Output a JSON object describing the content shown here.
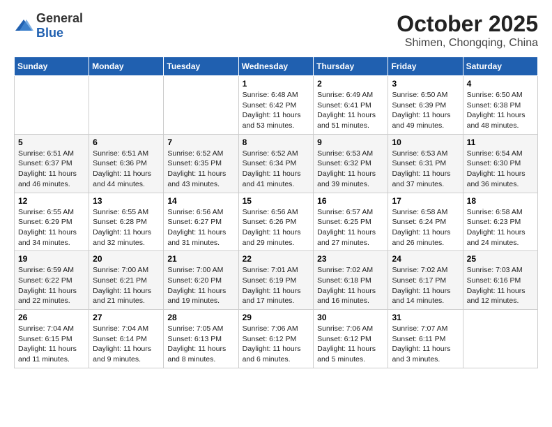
{
  "logo": {
    "general": "General",
    "blue": "Blue"
  },
  "header": {
    "month": "October 2025",
    "location": "Shimen, Chongqing, China"
  },
  "weekdays": [
    "Sunday",
    "Monday",
    "Tuesday",
    "Wednesday",
    "Thursday",
    "Friday",
    "Saturday"
  ],
  "weeks": [
    [
      {
        "day": "",
        "info": ""
      },
      {
        "day": "",
        "info": ""
      },
      {
        "day": "",
        "info": ""
      },
      {
        "day": "1",
        "info": "Sunrise: 6:48 AM\nSunset: 6:42 PM\nDaylight: 11 hours\nand 53 minutes."
      },
      {
        "day": "2",
        "info": "Sunrise: 6:49 AM\nSunset: 6:41 PM\nDaylight: 11 hours\nand 51 minutes."
      },
      {
        "day": "3",
        "info": "Sunrise: 6:50 AM\nSunset: 6:39 PM\nDaylight: 11 hours\nand 49 minutes."
      },
      {
        "day": "4",
        "info": "Sunrise: 6:50 AM\nSunset: 6:38 PM\nDaylight: 11 hours\nand 48 minutes."
      }
    ],
    [
      {
        "day": "5",
        "info": "Sunrise: 6:51 AM\nSunset: 6:37 PM\nDaylight: 11 hours\nand 46 minutes."
      },
      {
        "day": "6",
        "info": "Sunrise: 6:51 AM\nSunset: 6:36 PM\nDaylight: 11 hours\nand 44 minutes."
      },
      {
        "day": "7",
        "info": "Sunrise: 6:52 AM\nSunset: 6:35 PM\nDaylight: 11 hours\nand 43 minutes."
      },
      {
        "day": "8",
        "info": "Sunrise: 6:52 AM\nSunset: 6:34 PM\nDaylight: 11 hours\nand 41 minutes."
      },
      {
        "day": "9",
        "info": "Sunrise: 6:53 AM\nSunset: 6:32 PM\nDaylight: 11 hours\nand 39 minutes."
      },
      {
        "day": "10",
        "info": "Sunrise: 6:53 AM\nSunset: 6:31 PM\nDaylight: 11 hours\nand 37 minutes."
      },
      {
        "day": "11",
        "info": "Sunrise: 6:54 AM\nSunset: 6:30 PM\nDaylight: 11 hours\nand 36 minutes."
      }
    ],
    [
      {
        "day": "12",
        "info": "Sunrise: 6:55 AM\nSunset: 6:29 PM\nDaylight: 11 hours\nand 34 minutes."
      },
      {
        "day": "13",
        "info": "Sunrise: 6:55 AM\nSunset: 6:28 PM\nDaylight: 11 hours\nand 32 minutes."
      },
      {
        "day": "14",
        "info": "Sunrise: 6:56 AM\nSunset: 6:27 PM\nDaylight: 11 hours\nand 31 minutes."
      },
      {
        "day": "15",
        "info": "Sunrise: 6:56 AM\nSunset: 6:26 PM\nDaylight: 11 hours\nand 29 minutes."
      },
      {
        "day": "16",
        "info": "Sunrise: 6:57 AM\nSunset: 6:25 PM\nDaylight: 11 hours\nand 27 minutes."
      },
      {
        "day": "17",
        "info": "Sunrise: 6:58 AM\nSunset: 6:24 PM\nDaylight: 11 hours\nand 26 minutes."
      },
      {
        "day": "18",
        "info": "Sunrise: 6:58 AM\nSunset: 6:23 PM\nDaylight: 11 hours\nand 24 minutes."
      }
    ],
    [
      {
        "day": "19",
        "info": "Sunrise: 6:59 AM\nSunset: 6:22 PM\nDaylight: 11 hours\nand 22 minutes."
      },
      {
        "day": "20",
        "info": "Sunrise: 7:00 AM\nSunset: 6:21 PM\nDaylight: 11 hours\nand 21 minutes."
      },
      {
        "day": "21",
        "info": "Sunrise: 7:00 AM\nSunset: 6:20 PM\nDaylight: 11 hours\nand 19 minutes."
      },
      {
        "day": "22",
        "info": "Sunrise: 7:01 AM\nSunset: 6:19 PM\nDaylight: 11 hours\nand 17 minutes."
      },
      {
        "day": "23",
        "info": "Sunrise: 7:02 AM\nSunset: 6:18 PM\nDaylight: 11 hours\nand 16 minutes."
      },
      {
        "day": "24",
        "info": "Sunrise: 7:02 AM\nSunset: 6:17 PM\nDaylight: 11 hours\nand 14 minutes."
      },
      {
        "day": "25",
        "info": "Sunrise: 7:03 AM\nSunset: 6:16 PM\nDaylight: 11 hours\nand 12 minutes."
      }
    ],
    [
      {
        "day": "26",
        "info": "Sunrise: 7:04 AM\nSunset: 6:15 PM\nDaylight: 11 hours\nand 11 minutes."
      },
      {
        "day": "27",
        "info": "Sunrise: 7:04 AM\nSunset: 6:14 PM\nDaylight: 11 hours\nand 9 minutes."
      },
      {
        "day": "28",
        "info": "Sunrise: 7:05 AM\nSunset: 6:13 PM\nDaylight: 11 hours\nand 8 minutes."
      },
      {
        "day": "29",
        "info": "Sunrise: 7:06 AM\nSunset: 6:12 PM\nDaylight: 11 hours\nand 6 minutes."
      },
      {
        "day": "30",
        "info": "Sunrise: 7:06 AM\nSunset: 6:12 PM\nDaylight: 11 hours\nand 5 minutes."
      },
      {
        "day": "31",
        "info": "Sunrise: 7:07 AM\nSunset: 6:11 PM\nDaylight: 11 hours\nand 3 minutes."
      },
      {
        "day": "",
        "info": ""
      }
    ]
  ]
}
